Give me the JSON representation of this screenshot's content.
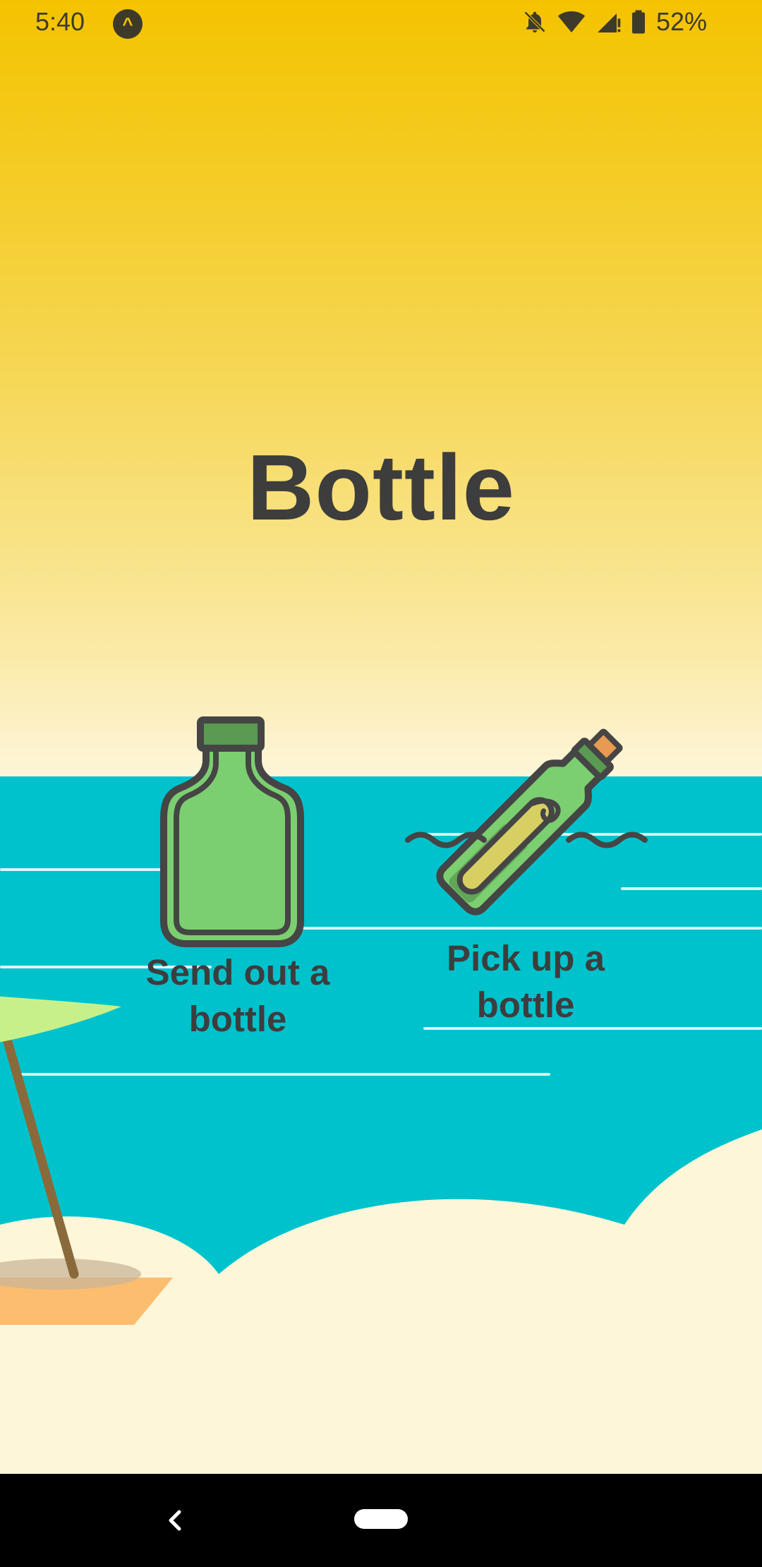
{
  "status_bar": {
    "time": "5:40",
    "app_icon": "expo-icon",
    "icons": [
      "notifications-off-icon",
      "wifi-icon",
      "cell-signal-icon",
      "battery-icon"
    ],
    "battery": "52%"
  },
  "app": {
    "title": "Bottle"
  },
  "options": [
    {
      "label": "Send out a bottle",
      "icon": "empty-bottle-icon"
    },
    {
      "label": "Pick up a bottle",
      "icon": "message-in-bottle-icon"
    }
  ],
  "nav_bar": {
    "icons": [
      "back-icon",
      "home-pill-icon"
    ]
  },
  "colors": {
    "sky_top": "#f4c300",
    "sky_bottom": "#fdf6dc",
    "sea": "#00c2cc",
    "sand": "#fdf6d8",
    "text": "#3d3d3d",
    "bottle_green": "#7ccf70",
    "bottle_dark": "#5a9a52"
  }
}
